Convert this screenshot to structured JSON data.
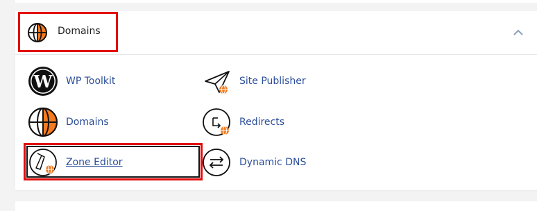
{
  "panel": {
    "title": "Domains",
    "header_icon": "globe-icon",
    "collapse_icon": "chevron-up-icon"
  },
  "items": [
    {
      "label": "WP Toolkit",
      "icon": "wordpress-icon"
    },
    {
      "label": "Site Publisher",
      "icon": "paper-plane-globe-icon"
    },
    {
      "label": "Domains",
      "icon": "globe-icon"
    },
    {
      "label": "Redirects",
      "icon": "redirect-globe-icon"
    },
    {
      "label": "Zone Editor",
      "icon": "compass-globe-icon"
    },
    {
      "label": "Dynamic DNS",
      "icon": "arrows-exchange-icon"
    }
  ],
  "colors": {
    "accent": "#f47b20",
    "link": "#2b4d99",
    "highlight": "#e10b0b"
  }
}
